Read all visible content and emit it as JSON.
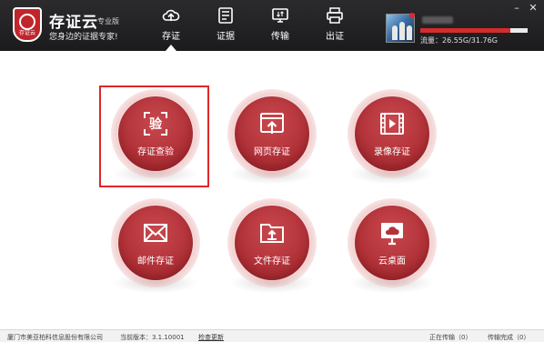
{
  "header": {
    "logo_text": "存证云",
    "app_name": "存证云",
    "edition": "专业版",
    "slogan": "您身边的证据专家!",
    "nav": [
      {
        "label": "存证",
        "icon": "cloud-upload-icon",
        "active": true
      },
      {
        "label": "证据",
        "icon": "document-list-icon",
        "active": false
      },
      {
        "label": "传输",
        "icon": "transfer-icon",
        "active": false
      },
      {
        "label": "出证",
        "icon": "printer-icon",
        "active": false
      }
    ],
    "storage": {
      "label": "流量：26.55G/31.76G",
      "used_fraction": 0.836
    },
    "window_controls": {
      "minimize": "–",
      "close": "✕"
    }
  },
  "tiles": [
    {
      "label": "存证查验",
      "icon": "verify-icon",
      "selected": true
    },
    {
      "label": "网页存证",
      "icon": "web-capture-icon",
      "selected": false
    },
    {
      "label": "录像存证",
      "icon": "video-icon",
      "selected": false
    },
    {
      "label": "邮件存证",
      "icon": "mail-icon",
      "selected": false
    },
    {
      "label": "文件存证",
      "icon": "folder-upload-icon",
      "selected": false
    },
    {
      "label": "云桌面",
      "icon": "cloud-desktop-icon",
      "selected": false
    }
  ],
  "verify_icon_char": "验",
  "statusbar": {
    "company": "厦门市美亚柏科信息股份有限公司",
    "version": "当前版本：3.1.10001",
    "check_update": "检查更新",
    "uploading": "正在传输（0）",
    "completed": "传输完成（0）"
  },
  "colors": {
    "header_bg": "#222224",
    "accent_red": "#b3333a",
    "selection_border": "#e0262a"
  }
}
